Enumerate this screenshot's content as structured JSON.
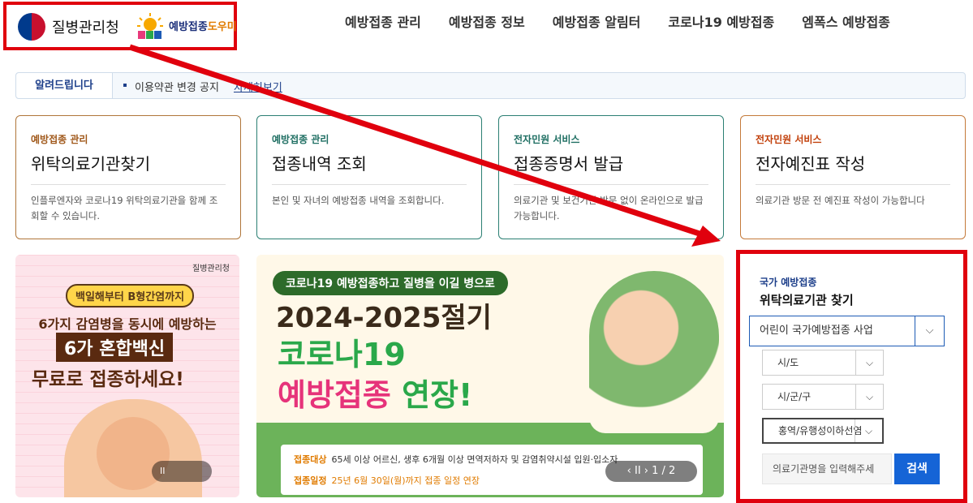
{
  "header": {
    "kdca_name": "질병관리청",
    "nip_name_main": "예방접종",
    "nip_name_sub": "도우미",
    "nav": [
      "예방접종 관리",
      "예방접종 정보",
      "예방접종 알림터",
      "코로나19 예방접종",
      "엠폭스 예방접종"
    ]
  },
  "notice": {
    "label": "알려드립니다",
    "text": "이용약관 변경 공지",
    "link": "자세히보기"
  },
  "cards": [
    {
      "category": "예방접종 관리",
      "title": "위탁의료기관찾기",
      "desc": "인플루엔자와 코로나19 위탁의료기관을 함께 조회할 수 있습니다."
    },
    {
      "category": "예방접종 관리",
      "title": "접종내역 조회",
      "desc": "본인 및 자녀의 예방접종 내역을 조회합니다."
    },
    {
      "category": "전자민원 서비스",
      "title": "접종증명서 발급",
      "desc": "의료기관 및 보건기관 방문 없이 온라인으로 발급가능합니다."
    },
    {
      "category": "전자민원 서비스",
      "title": "전자예진표 작성",
      "desc": "의료기관 방문 전 예진표 작성이 가능합니다"
    }
  ],
  "banner1": {
    "org": "질병관리청",
    "tag": "백일해부터 B형간염까지",
    "line1": "6가지 감염병을 동시에 예방하는",
    "line2": "6가 혼합백신",
    "line3": "무료로 접종하세요!",
    "pause": "II"
  },
  "banner2": {
    "tag": "코로나19 예방접종하고 질병을 이길 병으로",
    "year": "2024-2025절기",
    "line1": "코로나19",
    "line2a": "예방접종",
    "line2b": "연장!",
    "row1_label": "접종대상",
    "row1_text": "65세 이상 어르신, 생후 6개월 이상 면역저하자 및 감염취약시설 입원·입소자",
    "row2_label": "접종일정",
    "row2_text": "25년 6월 30일(월)까지 접종 일정 연장",
    "pager": "‹ II › 1 / 2"
  },
  "search": {
    "category": "국가 예방접종",
    "title": "위탁의료기관 찾기",
    "program": "어린이 국가예방접종 사업",
    "sido": "시/도",
    "sigungu": "시/군/구",
    "vaccine": "홍역/유행성이하선염",
    "input_placeholder": "의료기관명을 입력해주세",
    "button": "검색"
  },
  "colors": {
    "accent": "#1564d6",
    "highlight": "#e0000d",
    "brand": "#1d3f8a"
  }
}
